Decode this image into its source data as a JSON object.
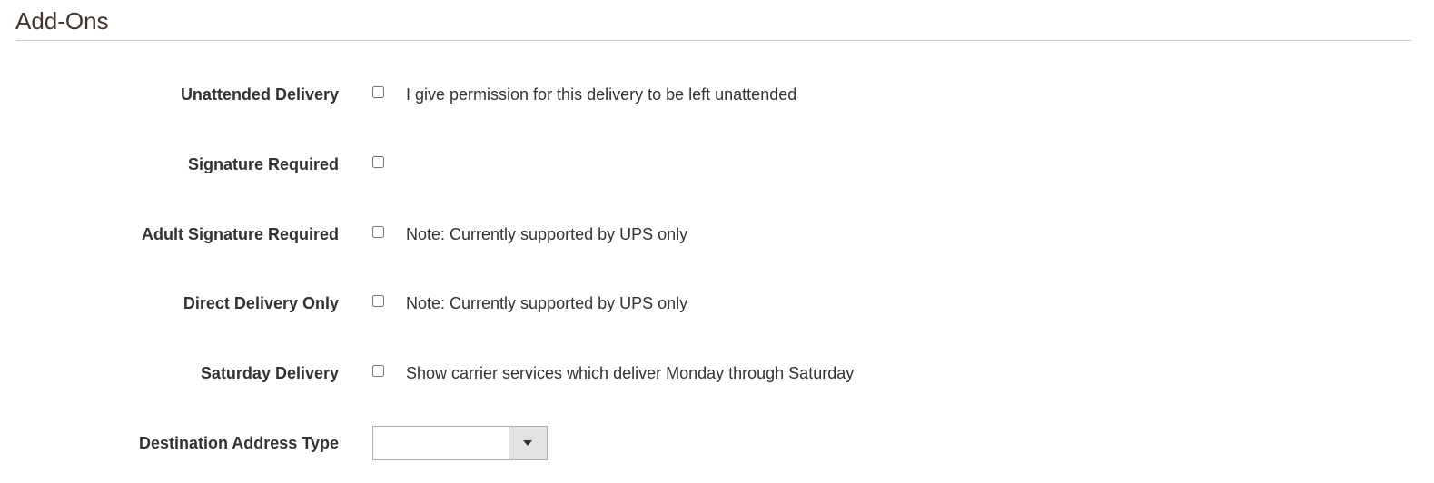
{
  "section": {
    "title": "Add-Ons"
  },
  "rows": [
    {
      "label": "Unattended Delivery",
      "note": "I give permission for this delivery to be left unattended",
      "checked": false
    },
    {
      "label": "Signature Required",
      "note": "",
      "checked": false
    },
    {
      "label": "Adult Signature Required",
      "note": "Note: Currently supported by UPS only",
      "checked": false
    },
    {
      "label": "Direct Delivery Only",
      "note": "Note: Currently supported by UPS only",
      "checked": false
    },
    {
      "label": "Saturday Delivery",
      "note": "Show carrier services which deliver Monday through Saturday",
      "checked": false
    }
  ],
  "destination": {
    "label": "Destination Address Type",
    "selected_value": ""
  },
  "colors": {
    "title": "#41362f",
    "text": "#333333",
    "border": "#adadad",
    "divider": "#cccccc"
  }
}
